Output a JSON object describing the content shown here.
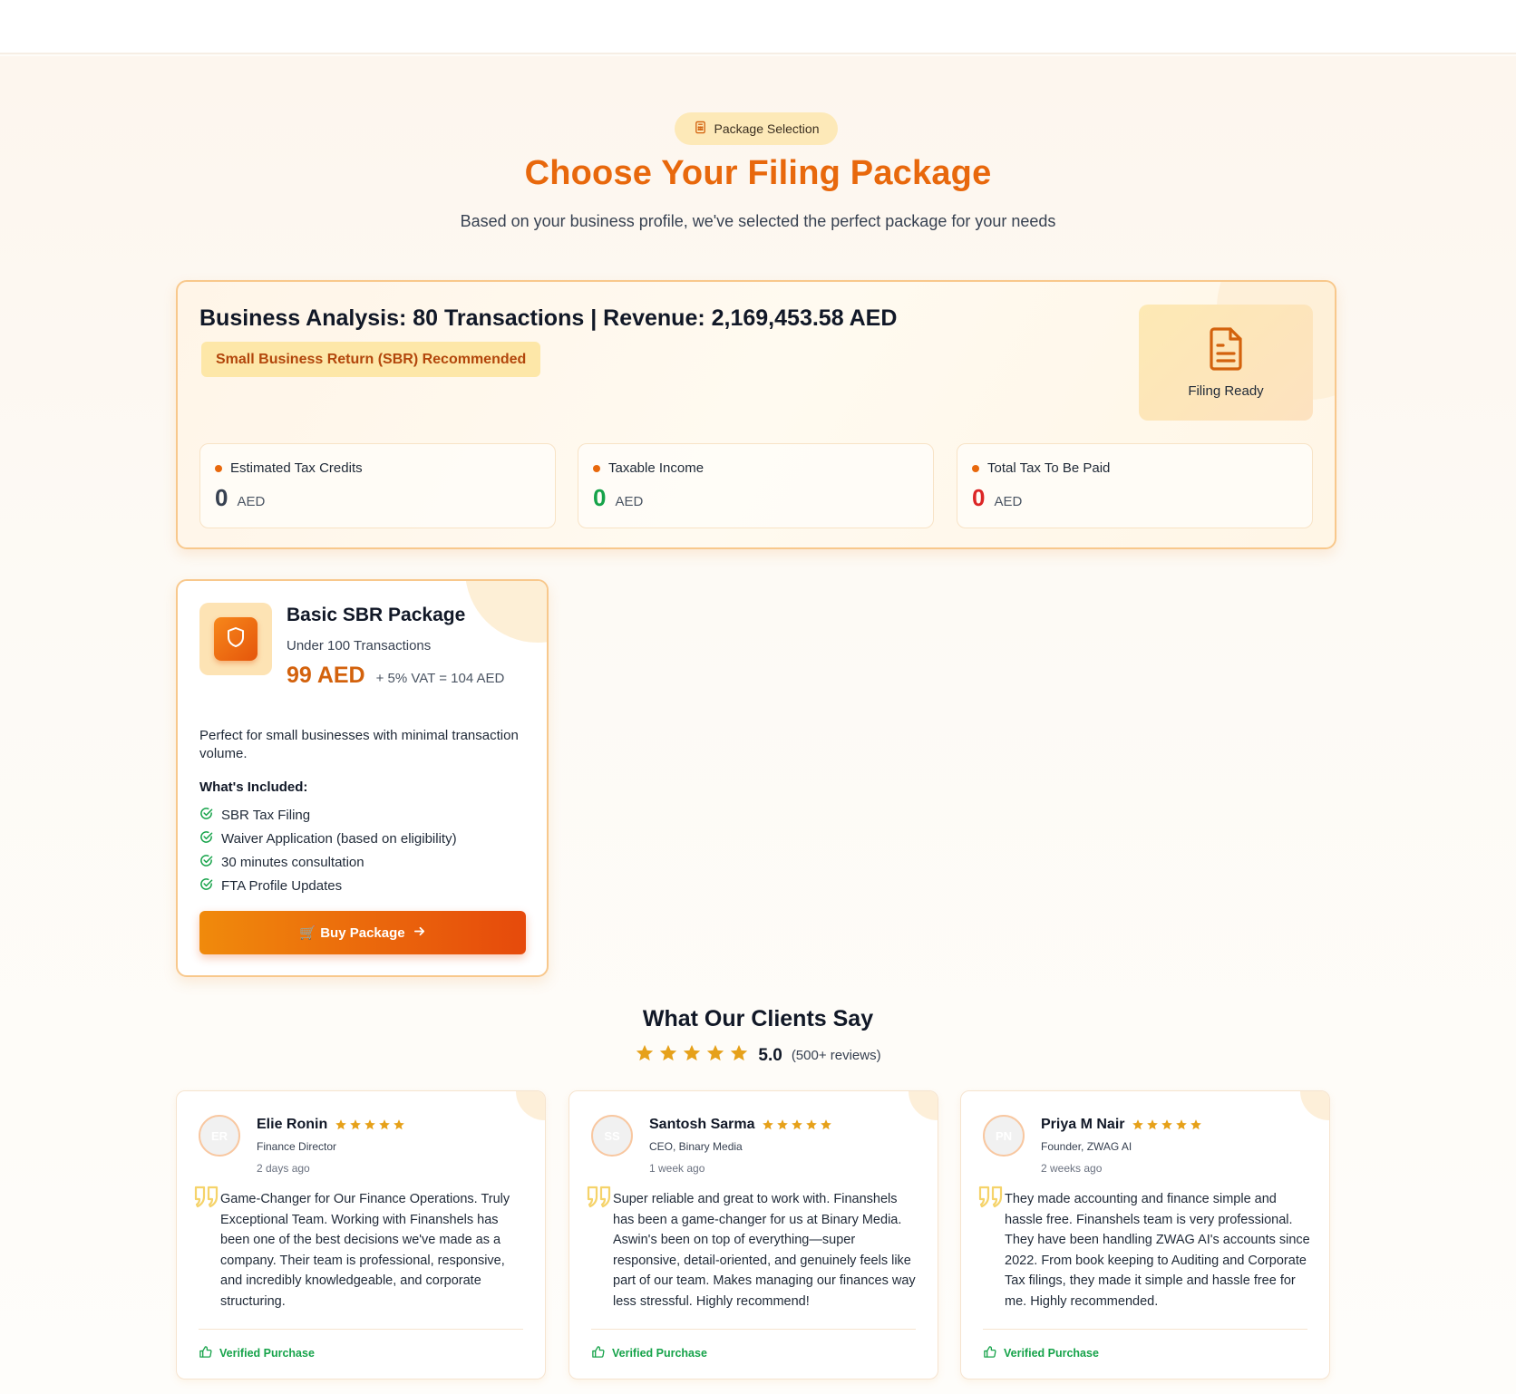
{
  "hero": {
    "pill_label": "Package Selection",
    "title": "Choose Your Filing Package",
    "subtitle": "Based on your business profile, we've selected the perfect package for your needs"
  },
  "analysis": {
    "heading": "Business Analysis: 80 Transactions | Revenue: 2,169,453.58 AED",
    "recommendation": "Small Business Return (SBR) Recommended",
    "filing_status": "Filing Ready",
    "stats": [
      {
        "label": "Estimated Tax Credits",
        "value": "0",
        "currency": "AED",
        "color": "#374151"
      },
      {
        "label": "Taxable Income",
        "value": "0",
        "currency": "AED",
        "color": "#16a34a"
      },
      {
        "label": "Total Tax To Be Paid",
        "value": "0",
        "currency": "AED",
        "color": "#dc2626"
      }
    ]
  },
  "package": {
    "name": "Basic SBR Package",
    "subtitle": "Under 100 Transactions",
    "price": "99 AED",
    "vat_note": "+ 5% VAT = 104 AED",
    "description": "Perfect for small businesses with minimal transaction volume.",
    "included_heading": "What's Included:",
    "features": [
      "SBR Tax Filing",
      "Waiver Application (based on eligibility)",
      "30 minutes consultation",
      "FTA Profile Updates"
    ],
    "buy_label": "🛒 Buy Package"
  },
  "testimonials": {
    "title": "What Our Clients Say",
    "score": "5.0",
    "count": "(500+ reviews)",
    "star_color": "#e6a11a",
    "reviews": [
      {
        "initials": "ER",
        "name": "Elie Ronin",
        "role": "Finance Director",
        "time": "2 days ago",
        "text": "Game-Changer for Our Finance Operations. Truly Exceptional Team. Working with Finanshels has been one of the best decisions we've made as a company. Their team is professional, responsive, and incredibly knowledgeable, and corporate structuring.",
        "verified": "Verified Purchase"
      },
      {
        "initials": "SS",
        "name": "Santosh Sarma",
        "role": "CEO, Binary Media",
        "time": "1 week ago",
        "text": "Super reliable and great to work with. Finanshels has been a game-changer for us at Binary Media. Aswin's been on top of everything—super responsive, detail-oriented, and genuinely feels like part of our team. Makes managing our finances way less stressful. Highly recommend!",
        "verified": "Verified Purchase"
      },
      {
        "initials": "PN",
        "name": "Priya M Nair",
        "role": "Founder, ZWAG AI",
        "time": "2 weeks ago",
        "text": "They made accounting and finance simple and hassle free. Finanshels team is very professional. They have been handling ZWAG AI's accounts since 2022. From book keeping to Auditing and Corporate Tax filings, they made it simple and hassle free for me. Highly recommended.",
        "verified": "Verified Purchase"
      }
    ]
  }
}
